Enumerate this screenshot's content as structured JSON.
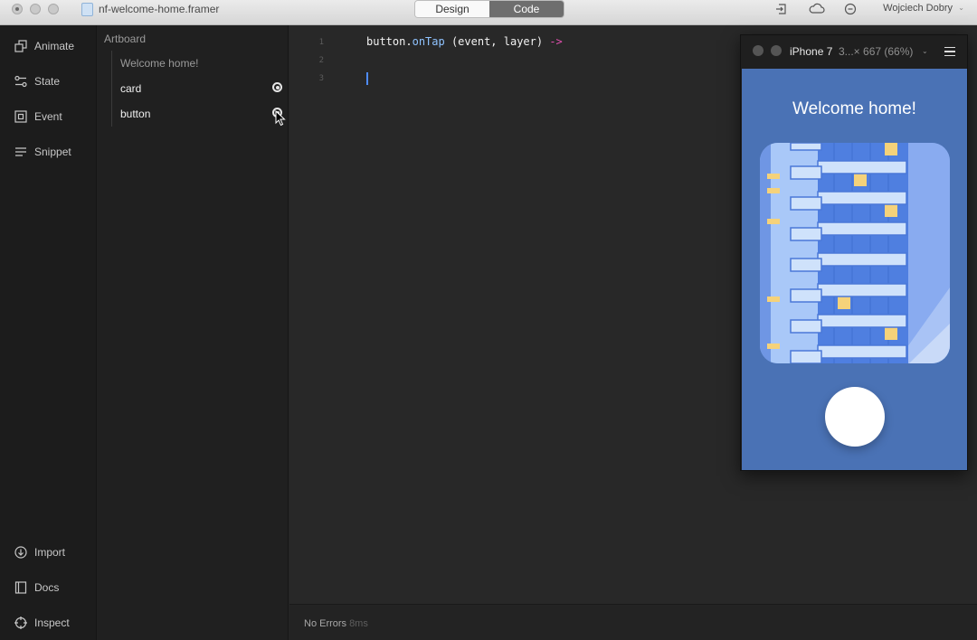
{
  "window": {
    "title": "nf-welcome-home.framer",
    "mode_tabs": [
      {
        "label": "Design",
        "active": false
      },
      {
        "label": "Code",
        "active": true
      }
    ],
    "user": "Wojciech Dobry"
  },
  "nav": {
    "top_items": [
      {
        "label": "Animate",
        "icon": "animate-icon"
      },
      {
        "label": "State",
        "icon": "state-icon"
      },
      {
        "label": "Event",
        "icon": "event-icon"
      },
      {
        "label": "Snippet",
        "icon": "snippet-icon"
      }
    ],
    "bottom_items": [
      {
        "label": "Import",
        "icon": "import-icon"
      },
      {
        "label": "Docs",
        "icon": "docs-icon"
      },
      {
        "label": "Inspect",
        "icon": "inspect-icon"
      }
    ]
  },
  "layers": {
    "section_label": "Artboard",
    "items": [
      {
        "label": "Welcome home!",
        "targetable": false
      },
      {
        "label": "card",
        "targetable": true
      },
      {
        "label": "button",
        "targetable": true
      }
    ]
  },
  "editor": {
    "line_numbers": [
      "1",
      "2",
      "3"
    ],
    "code": {
      "object": "button",
      "dot": ".",
      "method": "onTap",
      "args": " (event, layer) ",
      "arrow": "->"
    }
  },
  "status": {
    "text": "No Errors",
    "time": "8ms"
  },
  "preview": {
    "device": "iPhone 7",
    "size": "3...× 667 (66%)",
    "screen_title": "Welcome home!"
  },
  "colors": {
    "accent_blue": "#4e8cff",
    "screen_bg": "#4a72b5",
    "code_method": "#8fc3ff",
    "code_arrow": "#e24fb0"
  }
}
